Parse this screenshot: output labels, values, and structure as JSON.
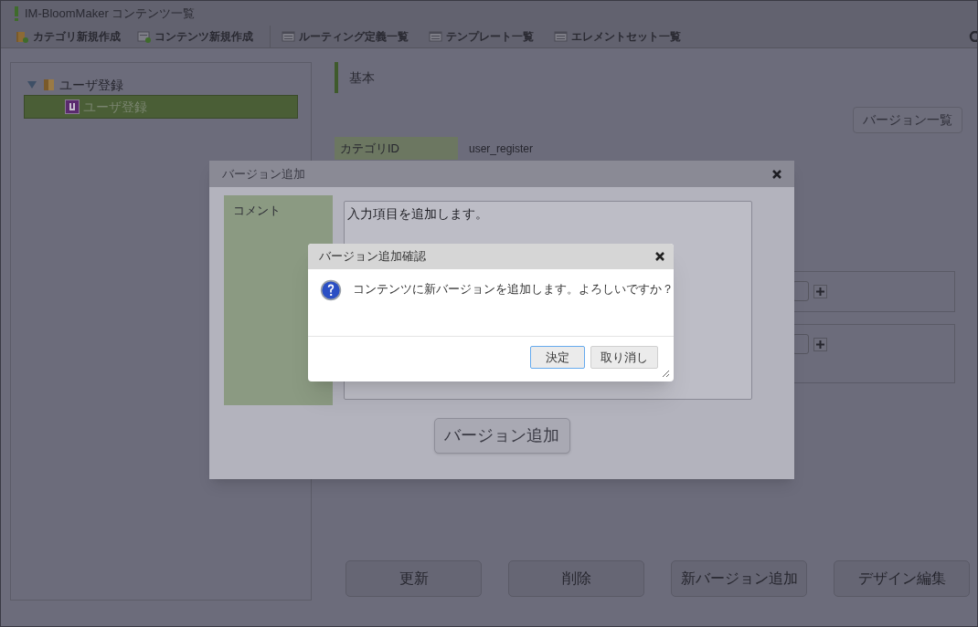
{
  "window": {
    "title": "IM-BloomMaker コンテンツ一覧"
  },
  "toolbar": [
    {
      "label": "カテゴリ新規作成",
      "kind": "create-category"
    },
    {
      "label": "コンテンツ新規作成",
      "kind": "create-content"
    },
    {
      "label": "ルーティング定義一覧",
      "kind": "list"
    },
    {
      "label": "テンプレート一覧",
      "kind": "list"
    },
    {
      "label": "エレメントセット一覧",
      "kind": "list"
    }
  ],
  "tree": [
    {
      "label": "ユーザ登録",
      "expanded": true,
      "selected": false,
      "children": [
        {
          "label": "ユーザ登録",
          "selected": true
        }
      ]
    }
  ],
  "detail": {
    "section_title": "基本",
    "version_list_button": "バージョン一覧",
    "fields": [
      {
        "label": "カテゴリID",
        "value": "user_register"
      }
    ],
    "buttons": [
      "更新",
      "削除",
      "新バージョン追加",
      "デザイン編集"
    ]
  },
  "add_version_dialog": {
    "title": "バージョン追加",
    "comment_label": "コメント",
    "comment_value": "入力項目を追加します。",
    "submit_button": "バージョン追加"
  },
  "confirm_dialog": {
    "title": "バージョン追加確認",
    "message": "コンテンツに新バージョンを追加します。よろしいですか？",
    "buttons": [
      {
        "label": "決定",
        "focused": true
      },
      {
        "label": "取り消し",
        "focused": false
      }
    ]
  }
}
